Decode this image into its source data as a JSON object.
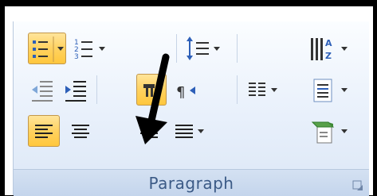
{
  "group": {
    "caption": "Paragraph"
  },
  "icons": {
    "bullets": "bullets-icon",
    "numbering": "numbering-icon",
    "line_spacing": "line-spacing-icon",
    "sort": "sort-icon",
    "decrease_indent": "decrease-indent-icon",
    "increase_indent": "increase-indent-icon",
    "ltr": "left-to-right-icon",
    "show_marks": "pilcrow-icon",
    "columns": "columns-icon",
    "spacing": "paragraph-spacing-icon",
    "align_left": "align-left-icon",
    "align_center": "align-center-icon",
    "align_right": "align-right-icon",
    "justify": "justify-icon",
    "shading": "shading-icon",
    "launcher": "dialog-launcher-icon"
  },
  "colors": {
    "accent_active": "#ffd260",
    "caption": "#3b5a86",
    "bullet_blue": "#2d5fb8",
    "arrow": "#000000"
  }
}
